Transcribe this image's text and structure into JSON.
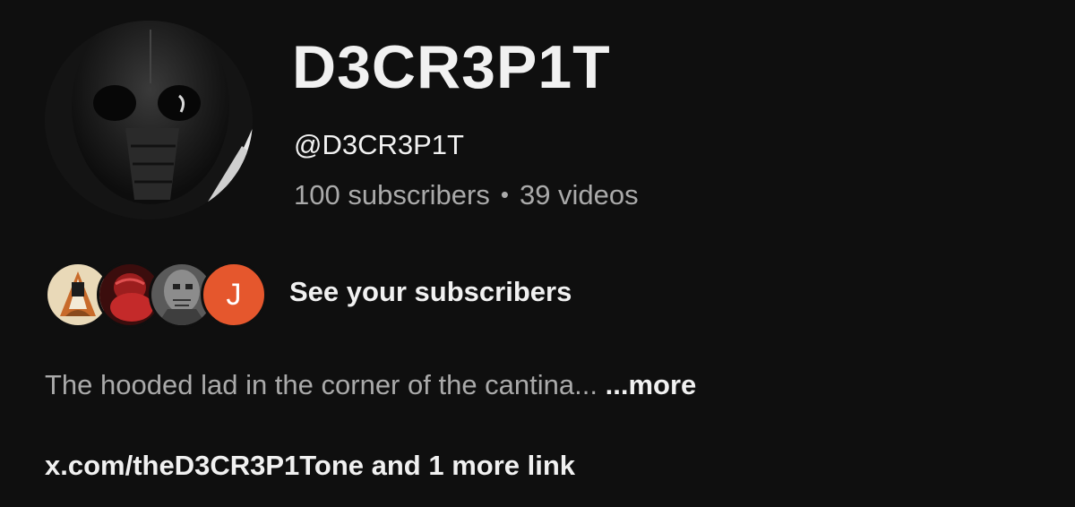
{
  "channel": {
    "name": "D3CR3P1T",
    "handle": "@D3CR3P1T",
    "subscribers": "100 subscribers",
    "separator": "•",
    "videos": "39 videos",
    "avatar_icon": "masked-figure-avatar"
  },
  "subscribers_preview": {
    "label": "See your subscribers",
    "avatars": [
      {
        "icon": "hooded-illustration-avatar"
      },
      {
        "icon": "red-figure-avatar"
      },
      {
        "icon": "grey-figure-avatar"
      },
      {
        "letter": "J",
        "color": "#e5572d"
      }
    ]
  },
  "description": {
    "text": "The hooded lad in the corner of the cantina...",
    "more_label": "...more"
  },
  "links": {
    "text": "x.com/theD3CR3P1Tone and 1 more link"
  },
  "colors": {
    "background": "#0f0f0f",
    "primary_text": "#f1f1f1",
    "secondary_text": "#aaaaaa",
    "letter_avatar": "#e5572d"
  }
}
